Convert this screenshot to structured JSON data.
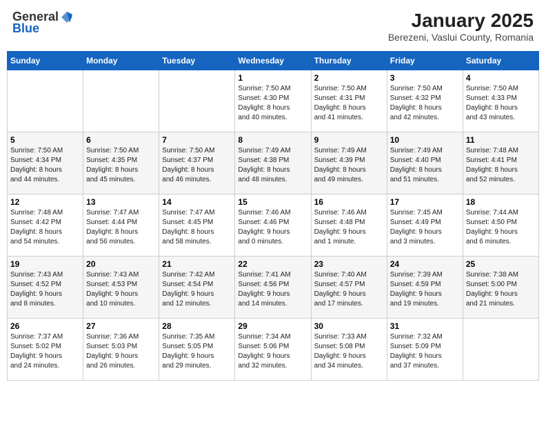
{
  "header": {
    "logo_line1": "General",
    "logo_line2": "Blue",
    "title": "January 2025",
    "subtitle": "Berezeni, Vaslui County, Romania"
  },
  "calendar": {
    "days_of_week": [
      "Sunday",
      "Monday",
      "Tuesday",
      "Wednesday",
      "Thursday",
      "Friday",
      "Saturday"
    ],
    "weeks": [
      [
        {
          "day": "",
          "info": ""
        },
        {
          "day": "",
          "info": ""
        },
        {
          "day": "",
          "info": ""
        },
        {
          "day": "1",
          "info": "Sunrise: 7:50 AM\nSunset: 4:30 PM\nDaylight: 8 hours\nand 40 minutes."
        },
        {
          "day": "2",
          "info": "Sunrise: 7:50 AM\nSunset: 4:31 PM\nDaylight: 8 hours\nand 41 minutes."
        },
        {
          "day": "3",
          "info": "Sunrise: 7:50 AM\nSunset: 4:32 PM\nDaylight: 8 hours\nand 42 minutes."
        },
        {
          "day": "4",
          "info": "Sunrise: 7:50 AM\nSunset: 4:33 PM\nDaylight: 8 hours\nand 43 minutes."
        }
      ],
      [
        {
          "day": "5",
          "info": "Sunrise: 7:50 AM\nSunset: 4:34 PM\nDaylight: 8 hours\nand 44 minutes."
        },
        {
          "day": "6",
          "info": "Sunrise: 7:50 AM\nSunset: 4:35 PM\nDaylight: 8 hours\nand 45 minutes."
        },
        {
          "day": "7",
          "info": "Sunrise: 7:50 AM\nSunset: 4:37 PM\nDaylight: 8 hours\nand 46 minutes."
        },
        {
          "day": "8",
          "info": "Sunrise: 7:49 AM\nSunset: 4:38 PM\nDaylight: 8 hours\nand 48 minutes."
        },
        {
          "day": "9",
          "info": "Sunrise: 7:49 AM\nSunset: 4:39 PM\nDaylight: 8 hours\nand 49 minutes."
        },
        {
          "day": "10",
          "info": "Sunrise: 7:49 AM\nSunset: 4:40 PM\nDaylight: 8 hours\nand 51 minutes."
        },
        {
          "day": "11",
          "info": "Sunrise: 7:48 AM\nSunset: 4:41 PM\nDaylight: 8 hours\nand 52 minutes."
        }
      ],
      [
        {
          "day": "12",
          "info": "Sunrise: 7:48 AM\nSunset: 4:42 PM\nDaylight: 8 hours\nand 54 minutes."
        },
        {
          "day": "13",
          "info": "Sunrise: 7:47 AM\nSunset: 4:44 PM\nDaylight: 8 hours\nand 56 minutes."
        },
        {
          "day": "14",
          "info": "Sunrise: 7:47 AM\nSunset: 4:45 PM\nDaylight: 8 hours\nand 58 minutes."
        },
        {
          "day": "15",
          "info": "Sunrise: 7:46 AM\nSunset: 4:46 PM\nDaylight: 9 hours\nand 0 minutes."
        },
        {
          "day": "16",
          "info": "Sunrise: 7:46 AM\nSunset: 4:48 PM\nDaylight: 9 hours\nand 1 minute."
        },
        {
          "day": "17",
          "info": "Sunrise: 7:45 AM\nSunset: 4:49 PM\nDaylight: 9 hours\nand 3 minutes."
        },
        {
          "day": "18",
          "info": "Sunrise: 7:44 AM\nSunset: 4:50 PM\nDaylight: 9 hours\nand 6 minutes."
        }
      ],
      [
        {
          "day": "19",
          "info": "Sunrise: 7:43 AM\nSunset: 4:52 PM\nDaylight: 9 hours\nand 8 minutes."
        },
        {
          "day": "20",
          "info": "Sunrise: 7:43 AM\nSunset: 4:53 PM\nDaylight: 9 hours\nand 10 minutes."
        },
        {
          "day": "21",
          "info": "Sunrise: 7:42 AM\nSunset: 4:54 PM\nDaylight: 9 hours\nand 12 minutes."
        },
        {
          "day": "22",
          "info": "Sunrise: 7:41 AM\nSunset: 4:56 PM\nDaylight: 9 hours\nand 14 minutes."
        },
        {
          "day": "23",
          "info": "Sunrise: 7:40 AM\nSunset: 4:57 PM\nDaylight: 9 hours\nand 17 minutes."
        },
        {
          "day": "24",
          "info": "Sunrise: 7:39 AM\nSunset: 4:59 PM\nDaylight: 9 hours\nand 19 minutes."
        },
        {
          "day": "25",
          "info": "Sunrise: 7:38 AM\nSunset: 5:00 PM\nDaylight: 9 hours\nand 21 minutes."
        }
      ],
      [
        {
          "day": "26",
          "info": "Sunrise: 7:37 AM\nSunset: 5:02 PM\nDaylight: 9 hours\nand 24 minutes."
        },
        {
          "day": "27",
          "info": "Sunrise: 7:36 AM\nSunset: 5:03 PM\nDaylight: 9 hours\nand 26 minutes."
        },
        {
          "day": "28",
          "info": "Sunrise: 7:35 AM\nSunset: 5:05 PM\nDaylight: 9 hours\nand 29 minutes."
        },
        {
          "day": "29",
          "info": "Sunrise: 7:34 AM\nSunset: 5:06 PM\nDaylight: 9 hours\nand 32 minutes."
        },
        {
          "day": "30",
          "info": "Sunrise: 7:33 AM\nSunset: 5:08 PM\nDaylight: 9 hours\nand 34 minutes."
        },
        {
          "day": "31",
          "info": "Sunrise: 7:32 AM\nSunset: 5:09 PM\nDaylight: 9 hours\nand 37 minutes."
        },
        {
          "day": "",
          "info": ""
        }
      ]
    ]
  }
}
